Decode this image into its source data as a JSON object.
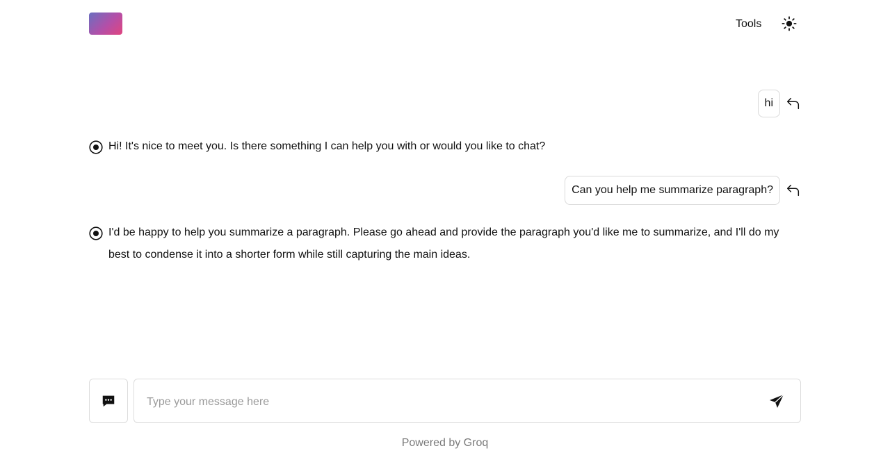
{
  "header": {
    "tools_label": "Tools",
    "theme_icon": "sun-icon"
  },
  "conversation": {
    "messages": [
      {
        "role": "user",
        "text": "hi"
      },
      {
        "role": "assistant",
        "text": "Hi! It's nice to meet you. Is there something I can help you with or would you like to chat?"
      },
      {
        "role": "user",
        "text": "Can you help me summarize paragraph?"
      },
      {
        "role": "assistant",
        "text": "I'd be happy to help you summarize a paragraph. Please go ahead and provide the paragraph you'd like me to summarize, and I'll do my best to condense it into a shorter form while still capturing the main ideas."
      }
    ]
  },
  "composer": {
    "placeholder": "Type your message here",
    "value": ""
  },
  "footer": {
    "text": "Powered by Groq"
  }
}
